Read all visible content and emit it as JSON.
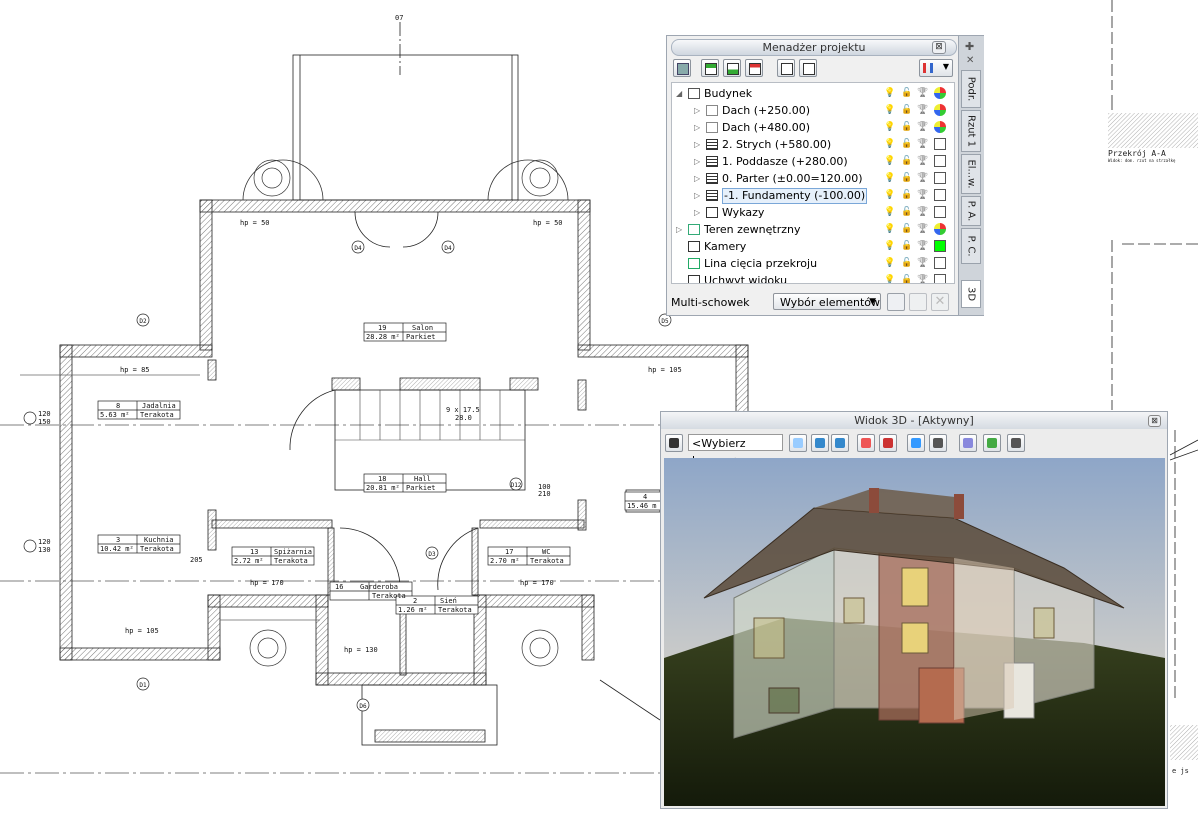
{
  "plan": {
    "top_mark": "07",
    "section_label": "Przekrój A-A",
    "section_note": "Widok: dom. rzut na strzałkę",
    "edge_label": "e js",
    "room_labels": [
      {
        "num": "19",
        "name": "Salon",
        "area": "28.28 m²",
        "floor": "Parkiet"
      },
      {
        "num": "18",
        "name": "Hall",
        "area": "20.81 m²",
        "floor": "Parkiet"
      },
      {
        "num": "8",
        "name": "Jadalnia",
        "area": "5.63 m²",
        "floor": "Terakota"
      },
      {
        "num": "3",
        "name": "Kuchnia",
        "area": "10.42 m²",
        "floor": "Terakota"
      },
      {
        "num": "13",
        "name": "Spiżarnia",
        "area": "2.72 m²",
        "floor": "Terakota"
      },
      {
        "num": "17",
        "name": "WC",
        "area": "2.70 m²",
        "floor": "Terakota"
      },
      {
        "num": "16",
        "name": "Garderoba",
        "area": "",
        "floor": "Terakota"
      },
      {
        "num": "2",
        "name": "Sień",
        "area": "1.26 m²",
        "floor": "Terakota"
      },
      {
        "num": "4",
        "name": "",
        "area": "15.46 m",
        "floor": ""
      }
    ],
    "heights": [
      "hp = 50",
      "hp = 50",
      "hp = 85",
      "hp = 105",
      "hp = 170",
      "hp = 170",
      "hp = 105",
      "hp = 130"
    ],
    "door_tags": [
      "D4",
      "D4",
      "D2",
      "D5",
      "D1",
      "D3",
      "D6",
      "D12"
    ],
    "stair_label": "9 x 17.5",
    "stair_sub": "28.0",
    "dims": [
      "120",
      "150",
      "120",
      "130",
      "100",
      "210",
      "205"
    ]
  },
  "project_manager": {
    "title": "Menadżer projektu",
    "close": "⊠",
    "tree": [
      {
        "label": "Budynek",
        "level": 0,
        "expander": "◢",
        "icon": "house-icon",
        "color": "multi"
      },
      {
        "label": "Dach (+250.00)",
        "level": 1,
        "expander": "▷",
        "icon": "roof-icon",
        "color": "multi"
      },
      {
        "label": "Dach (+480.00)",
        "level": 1,
        "expander": "▷",
        "icon": "roof-icon",
        "color": "multi"
      },
      {
        "label": "2. Strych (+580.00)",
        "level": 1,
        "expander": "▷",
        "icon": "floor-icon",
        "color": "white"
      },
      {
        "label": "1. Poddasze (+280.00)",
        "level": 1,
        "expander": "▷",
        "icon": "floor-icon",
        "color": "white"
      },
      {
        "label": "0. Parter (±0.00=120.00)",
        "level": 1,
        "expander": "▷",
        "icon": "floor-icon",
        "color": "white"
      },
      {
        "label": "-1. Fundamenty (-100.00)",
        "level": 1,
        "expander": "▷",
        "icon": "floor-icon",
        "color": "white",
        "selected": true
      },
      {
        "label": "Wykazy",
        "level": 1,
        "expander": "▷",
        "icon": "list-icon",
        "color": "white"
      },
      {
        "label": "Teren zewnętrzny",
        "level": 0,
        "expander": "▷",
        "icon": "terrain-icon",
        "color": "multi"
      },
      {
        "label": "Kamery",
        "level": 0,
        "expander": "",
        "icon": "camera-icon",
        "color": "green"
      },
      {
        "label": "Lina cięcia przekroju",
        "level": 0,
        "expander": "",
        "icon": "section-line-icon",
        "color": "white"
      },
      {
        "label": "Uchwyt widoku",
        "level": 0,
        "expander": "",
        "icon": "view-handle-icon",
        "color": "white"
      }
    ],
    "multi_clipboard_label": "Multi-schowek",
    "selection_dropdown": "Wybór elementów",
    "side_tabs": [
      "Podr.",
      "Rzut 1",
      "El...w.",
      "P. A.",
      "P. C.",
      "3D"
    ],
    "colors": {
      "green": "#00ff00",
      "selected_border": "#7aa7d8",
      "bulb": "#c4a000"
    }
  },
  "view3d": {
    "title": "Widok 3D - [Aktywny]",
    "close": "⊠",
    "camera_placeholder": "<Wybierz kamerę>",
    "toolbar_icons": [
      "add-camera-icon",
      "camera-settings-icon",
      "perspective-icon",
      "axonometric-icon",
      "render-icon",
      "cut-plane-icon",
      "walk-icon",
      "light-icon",
      "texture-icon",
      "settings-icon",
      "export-3d-icon"
    ]
  }
}
